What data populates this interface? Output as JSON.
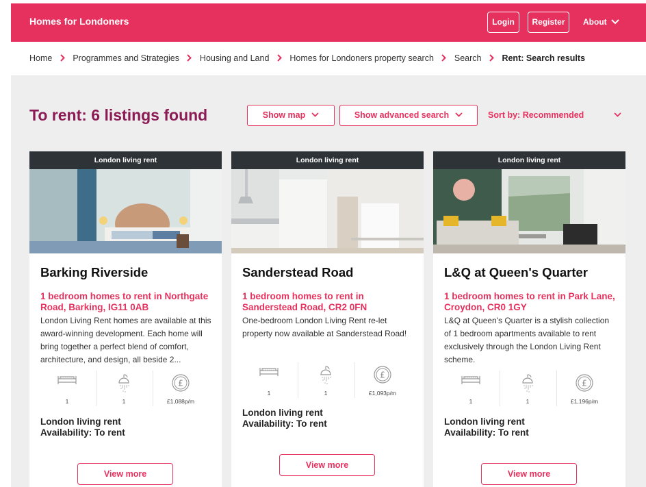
{
  "header": {
    "brand": "Homes for Londoners",
    "login_label": "Login",
    "register_label": "Register",
    "about_label": "About"
  },
  "breadcrumb": {
    "items": [
      "Home",
      "Programmes and Strategies",
      "Housing and Land",
      "Homes for Londoners property search",
      "Search"
    ],
    "current": "Rent: Search results"
  },
  "results": {
    "heading": "To rent: 6 listings found",
    "show_map_label": "Show map",
    "advanced_search_label": "Show advanced search",
    "sort_label": "Sort by: Recommended"
  },
  "listings": [
    {
      "tag": "London living rent",
      "title": "Barking Riverside",
      "subtitle": "1 bedroom homes to rent in Northgate Road, Barking, IG11 0AB",
      "description": "London Living Rent homes are available at this award-winning development. Each home will bring together a perfect blend of comfort, architecture, and design, all beside 2...",
      "bedrooms": "1",
      "bathrooms": "1",
      "price": "£1,088p/m",
      "rent_type": "London living rent",
      "availability": "Availability: To rent",
      "button_label": "View more"
    },
    {
      "tag": "London living rent",
      "title": "Sanderstead Road",
      "subtitle": "1 bedroom homes to rent in Sanderstead Road, CR2 0FN",
      "description": "One-bedroom London Living Rent re-let property now available at Sanderstead Road!",
      "bedrooms": "1",
      "bathrooms": "1",
      "price": "£1,093p/m",
      "rent_type": "London living rent",
      "availability": "Availability: To rent",
      "button_label": "View more"
    },
    {
      "tag": "London living rent",
      "title": "L&Q at Queen's Quarter",
      "subtitle": "1 bedroom homes to rent in Park Lane, Croydon, CR0 1GY",
      "description": "L&Q at Queen's Quarter is a stylish collection of 1 bedroom apartments available to rent exclusively through the London Living Rent scheme.",
      "bedrooms": "1",
      "bathrooms": "1",
      "price": "£1,196p/m",
      "rent_type": "London living rent",
      "availability": "Availability: To rent",
      "button_label": "View more"
    }
  ],
  "colors": {
    "brand": "#e6305e",
    "heading": "#8c1b55",
    "tag_bg": "#2e3337",
    "page_bg": "#eeeeee"
  },
  "icons": {
    "bed": "bed-icon",
    "shower": "shower-icon",
    "price": "pound-icon",
    "chevron": "chevron-down-icon",
    "breadcrumb_separator": "chevron-right-icon"
  }
}
